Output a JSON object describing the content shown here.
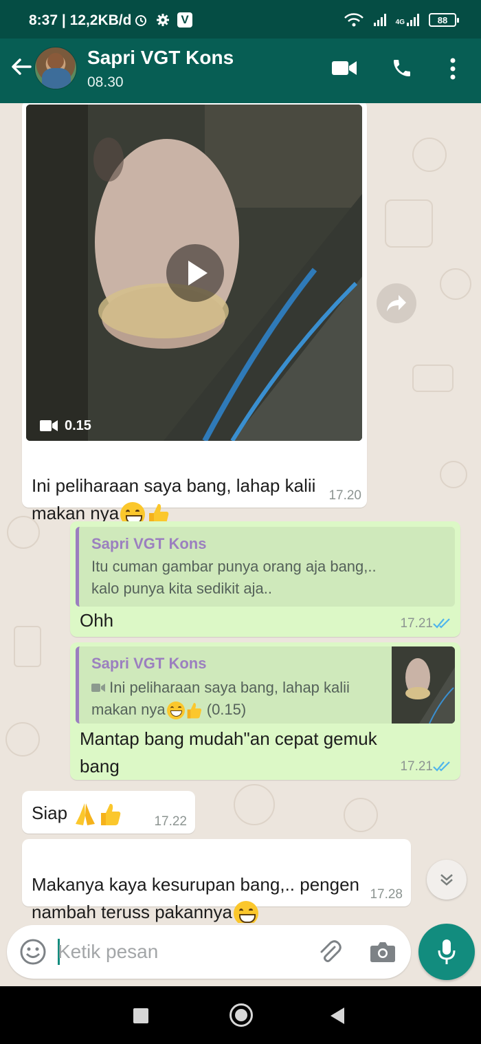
{
  "status_bar": {
    "time": "8:37",
    "network_speed": "| 12,2KB/d",
    "network_type": "4G",
    "battery": "88"
  },
  "header": {
    "contact_name": "Sapri VGT Kons",
    "last_seen": "08.30"
  },
  "messages": [
    {
      "direction": "incoming",
      "type": "video",
      "duration": "0.15",
      "text": "Ini peliharaan saya bang, lahap kalii\nmakan nya",
      "time": "17.20"
    },
    {
      "direction": "outgoing",
      "quote": {
        "name": "Sapri VGT Kons",
        "text": "Itu cuman gambar punya orang aja bang,..\nkalo punya kita sedikit aja.."
      },
      "text": "Ohh",
      "time": "17.21"
    },
    {
      "direction": "outgoing",
      "quote": {
        "name": "Sapri VGT Kons",
        "text_line1": "Ini peliharaan saya bang, lahap kalii",
        "text_line2": "makan nya",
        "duration": "(0.15)"
      },
      "text": "Mantap bang mudah\"an cepat gemuk\nbang",
      "time": "17.21"
    },
    {
      "direction": "incoming",
      "text": "Siap",
      "time": "17.22"
    },
    {
      "direction": "incoming",
      "text": "Makanya kaya kesurupan bang,.. pengen\nnambah teruss pakannya",
      "time": "17.28"
    }
  ],
  "input": {
    "placeholder": "Ketik pesan",
    "value": ""
  },
  "colors": {
    "header": "#075e54",
    "status_bar": "#054d44",
    "outgoing_bubble": "#dcf8c6",
    "incoming_bubble": "#ffffff",
    "chat_background": "#ece5dd",
    "accent": "#128c7e",
    "read_ticks": "#4fb5ec",
    "quote_name": "#9b7fbf"
  },
  "icons": [
    "back-arrow-icon",
    "video-call-icon",
    "phone-icon",
    "more-options-icon",
    "play-icon",
    "video-camera-icon",
    "forward-icon",
    "emoji-icon",
    "attach-icon",
    "camera-icon",
    "mic-icon",
    "scroll-down-icon",
    "read-receipt-icon",
    "nav-back-icon",
    "nav-home-icon",
    "nav-recents-icon"
  ]
}
